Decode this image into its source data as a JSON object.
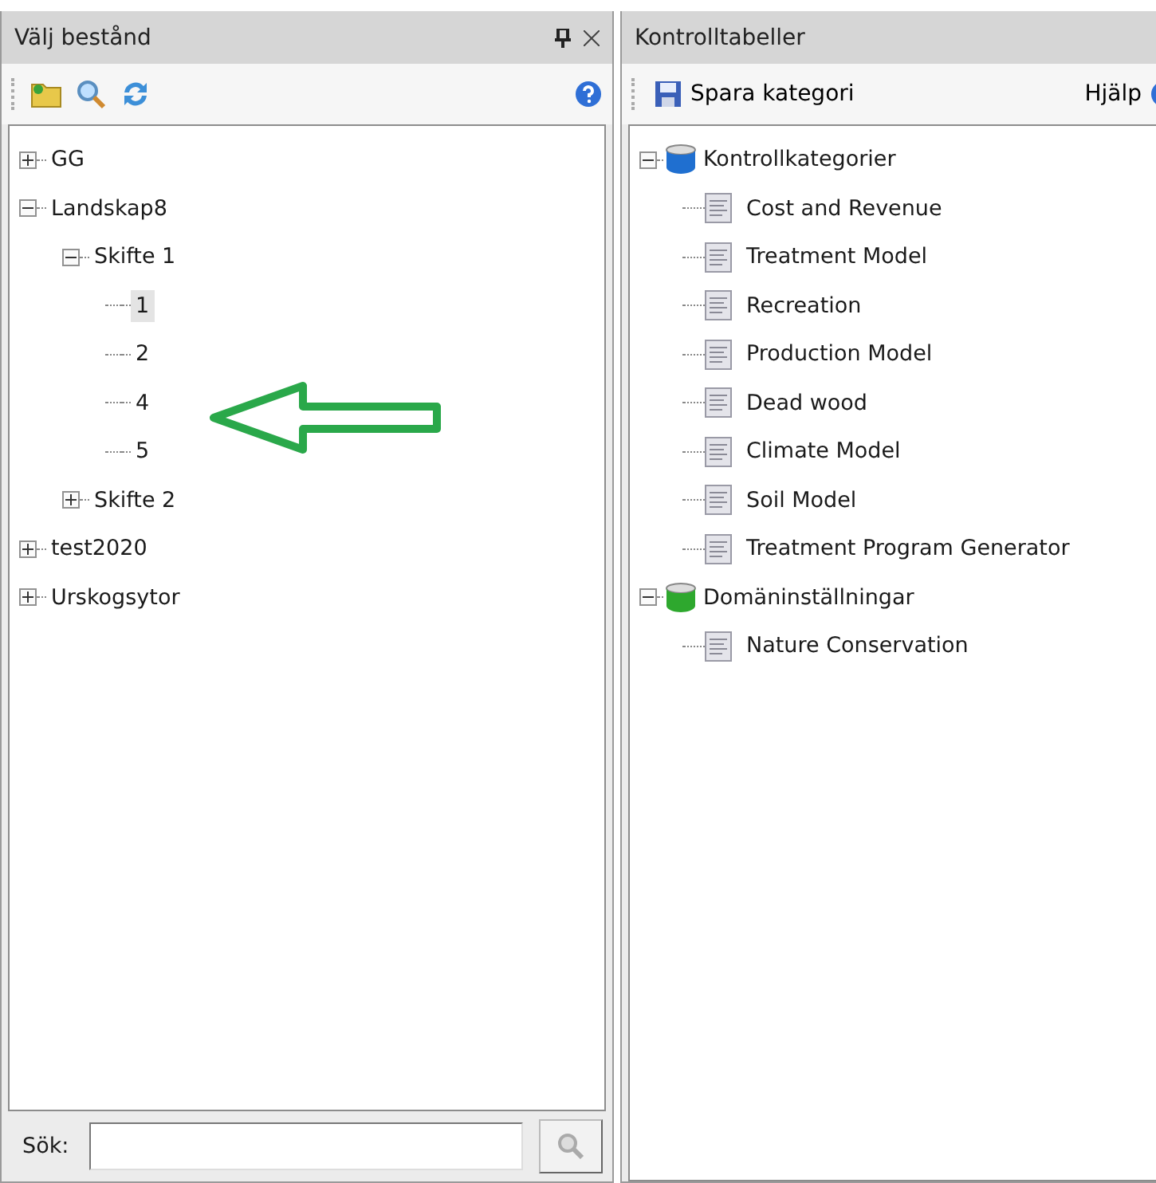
{
  "left_panel": {
    "title": "Välj bestånd",
    "tree": [
      {
        "label": "GG",
        "expanded": false,
        "selected": false
      },
      {
        "label": "Landskap8",
        "expanded": true,
        "selected": false,
        "children": [
          {
            "label": "Skifte 1",
            "expanded": true,
            "selected": false,
            "children": [
              {
                "label": "1",
                "selected": true
              },
              {
                "label": "2",
                "selected": false
              },
              {
                "label": "4",
                "selected": false
              },
              {
                "label": "5",
                "selected": false
              }
            ]
          },
          {
            "label": "Skifte 2",
            "expanded": false,
            "selected": false
          }
        ]
      },
      {
        "label": "test2020",
        "expanded": false,
        "selected": false
      },
      {
        "label": "Urskogsytor",
        "expanded": false,
        "selected": false
      }
    ],
    "search": {
      "label": "Sök:"
    }
  },
  "right_panel": {
    "title": "Kontrolltabeller",
    "toolbar": {
      "save": "Spara kategori",
      "help": "Hjälp"
    },
    "tree": [
      {
        "label": "Kontrollkategorier",
        "kind": "category",
        "expanded": true,
        "children": [
          {
            "label": "Cost and Revenue"
          },
          {
            "label": "Treatment Model"
          },
          {
            "label": "Recreation"
          },
          {
            "label": "Production Model"
          },
          {
            "label": "Dead wood"
          },
          {
            "label": "Climate Model"
          },
          {
            "label": "Soil Model"
          },
          {
            "label": "Treatment Program Generator"
          }
        ]
      },
      {
        "label": "Domäninställningar",
        "kind": "domain",
        "expanded": true,
        "children": [
          {
            "label": "Nature Conservation"
          }
        ]
      }
    ]
  }
}
